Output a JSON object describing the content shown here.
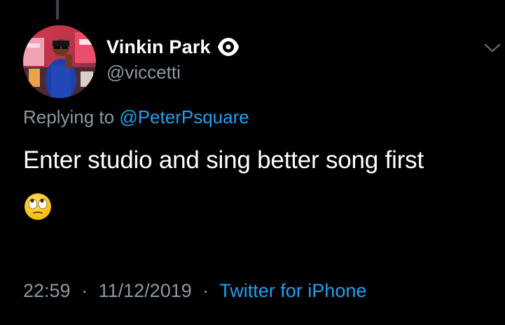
{
  "tweet": {
    "display_name": "Vinkin Park",
    "handle": "@viccetti",
    "replying_prefix": "Replying to",
    "replying_to": "@PeterPsquare",
    "text": "Enter studio and sing better song first",
    "emoji_name": "face-with-rolling-eyes",
    "time": "22:59",
    "date": "11/12/2019",
    "separator": "·",
    "source": "Twitter for iPhone",
    "badge_icon": "eye-icon",
    "menu_icon": "chevron-down-icon"
  },
  "colors": {
    "background": "#000000",
    "primary_text": "#ffffff",
    "secondary_text": "#8b98a5",
    "link": "#1da1f2"
  }
}
